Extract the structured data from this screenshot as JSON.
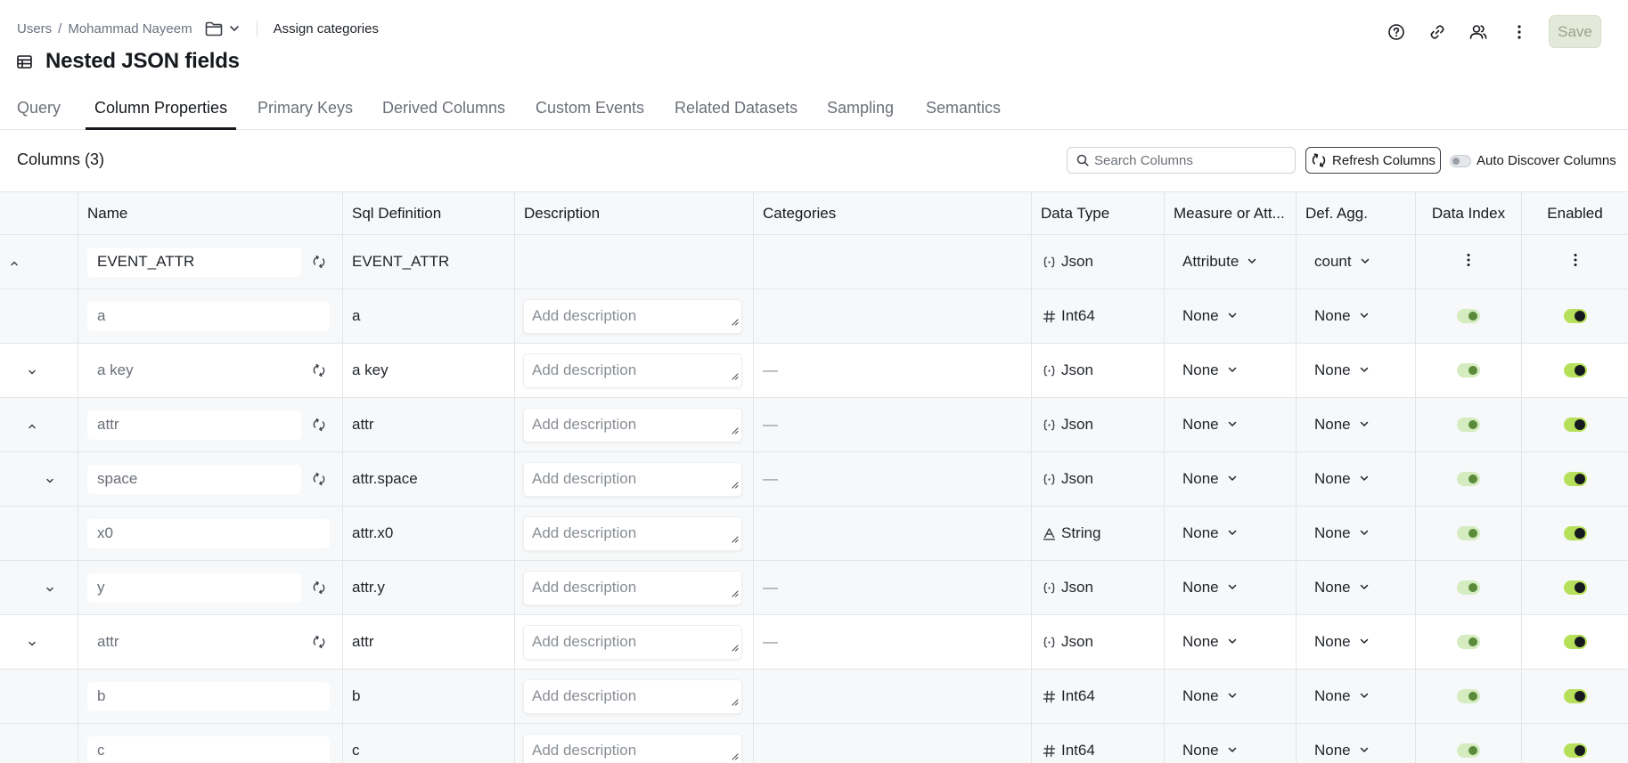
{
  "header": {
    "breadcrumb": [
      "Users",
      "Mohammad Nayeem"
    ],
    "breadcrumb_sep": "/",
    "assign_label": "Assign categories",
    "title": "Nested JSON fields",
    "save_label": "Save"
  },
  "tabs": [
    {
      "label": "Query",
      "active": false
    },
    {
      "label": "Column Properties",
      "active": true
    },
    {
      "label": "Primary Keys",
      "active": false
    },
    {
      "label": "Derived Columns",
      "active": false
    },
    {
      "label": "Custom Events",
      "active": false
    },
    {
      "label": "Related Datasets",
      "active": false
    },
    {
      "label": "Sampling",
      "active": false
    },
    {
      "label": "Semantics",
      "active": false
    }
  ],
  "toolbar": {
    "columns_count": "Columns (3)",
    "search_placeholder": "Search Columns",
    "refresh_label": "Refresh Columns",
    "auto_discover_label": "Auto Discover Columns"
  },
  "table": {
    "headers": {
      "name": "Name",
      "sql": "Sql Definition",
      "description": "Description",
      "categories": "Categories",
      "data_type": "Data Type",
      "measure": "Measure or Att...",
      "def_agg": "Def. Agg.",
      "data_index": "Data Index",
      "enabled": "Enabled"
    },
    "desc_placeholder": "Add description",
    "rows": [
      {
        "chevron": "up",
        "name": "EVENT_ATTR",
        "sql": "EVENT_ATTR",
        "desc": "",
        "categories": "",
        "type": "Json",
        "type_icon": "json-icon",
        "measure": "Attribute",
        "agg": "count",
        "controls": "menu",
        "sync": true
      },
      {
        "chevron": "",
        "name": "a",
        "sql": "a",
        "desc": "Add description",
        "categories": "",
        "type": "Int64",
        "type_icon": "hash-icon",
        "measure": "None",
        "agg": "None",
        "controls": "toggle",
        "sync": false
      },
      {
        "chevron": "down",
        "name": "a key",
        "sql": "a key",
        "desc": "Add description",
        "categories": "—",
        "type": "Json",
        "type_icon": "json-icon",
        "measure": "None",
        "agg": "None",
        "controls": "toggle",
        "sync": true
      },
      {
        "chevron": "up",
        "name": "attr",
        "sql": "attr",
        "desc": "Add description",
        "categories": "—",
        "type": "Json",
        "type_icon": "json-icon",
        "measure": "None",
        "agg": "None",
        "controls": "toggle",
        "sync": true
      },
      {
        "chevron": "down",
        "name": "space",
        "sql": "attr.space",
        "desc": "Add description",
        "categories": "—",
        "type": "Json",
        "type_icon": "json-icon",
        "measure": "None",
        "agg": "None",
        "controls": "toggle",
        "sync": true
      },
      {
        "chevron": "",
        "name": "x0",
        "sql": "attr.x0",
        "desc": "Add description",
        "categories": "",
        "type": "String",
        "type_icon": "string-icon",
        "measure": "None",
        "agg": "None",
        "controls": "toggle",
        "sync": false
      },
      {
        "chevron": "down",
        "name": "y",
        "sql": "attr.y",
        "desc": "Add description",
        "categories": "—",
        "type": "Json",
        "type_icon": "json-icon",
        "measure": "None",
        "agg": "None",
        "controls": "toggle",
        "sync": true
      },
      {
        "chevron": "down",
        "name": "attr",
        "sql": "attr",
        "desc": "Add description",
        "categories": "—",
        "type": "Json",
        "type_icon": "json-icon",
        "measure": "None",
        "agg": "None",
        "controls": "toggle",
        "sync": true
      },
      {
        "chevron": "",
        "name": "b",
        "sql": "b",
        "desc": "Add description",
        "categories": "",
        "type": "Int64",
        "type_icon": "hash-icon",
        "measure": "None",
        "agg": "None",
        "controls": "toggle",
        "sync": false
      },
      {
        "chevron": "",
        "name": "c",
        "sql": "c",
        "desc": "Add description",
        "categories": "",
        "type": "Int64",
        "type_icon": "hash-icon",
        "measure": "None",
        "agg": "None",
        "controls": "toggle",
        "sync": false
      }
    ]
  }
}
